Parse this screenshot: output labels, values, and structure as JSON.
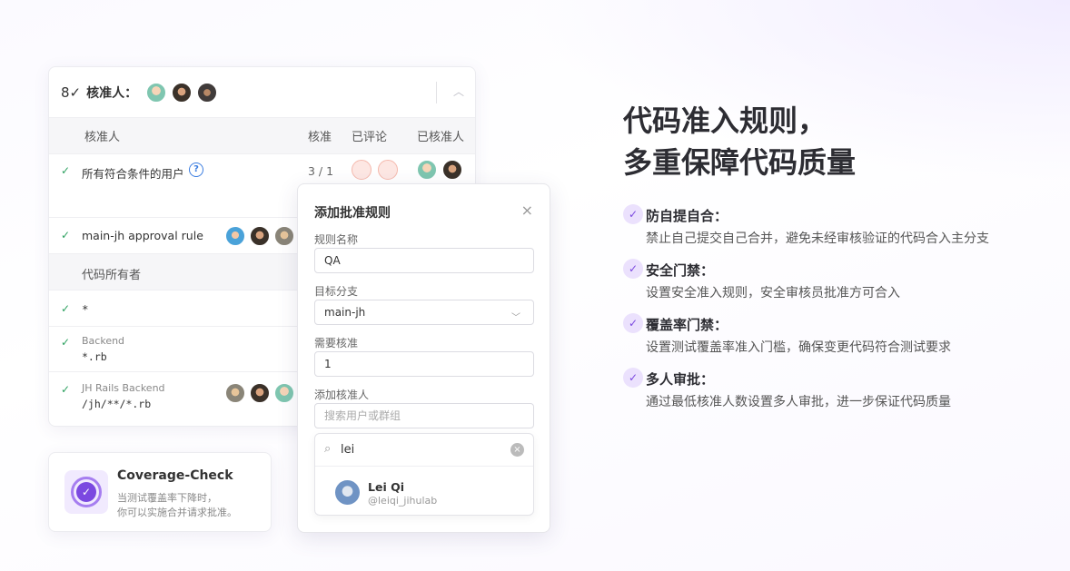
{
  "approvers_card": {
    "header_icon": "user-check-icon",
    "header_title": "核准人：",
    "table_headers": {
      "approvers": "核准人",
      "approve": "核准",
      "commented": "已评论",
      "approved_by": "已核准人"
    },
    "rows": [
      {
        "label": "所有符合条件的用户",
        "count": "3 / 1"
      },
      {
        "label": "main-jh approval rule"
      }
    ],
    "code_owners_header": "代码所有者",
    "code_owner_rows": [
      {
        "path": "*"
      },
      {
        "sub": "Backend",
        "path": "*.rb"
      },
      {
        "sub": "JH Rails Backend",
        "path": "/jh/**/*.rb"
      }
    ]
  },
  "coverage_card": {
    "title": "Coverage-Check",
    "desc_line1": "当测试覆盖率下降时，",
    "desc_line2": "你可以实施合并请求批准。"
  },
  "modal": {
    "title": "添加批准规则",
    "close": "×",
    "rule_name_label": "规则名称",
    "rule_name_value": "QA",
    "target_branch_label": "目标分支",
    "target_branch_value": "main-jh",
    "required_label": "需要核准",
    "required_value": "1",
    "add_approvers_label": "添加核准人",
    "add_approvers_placeholder": "搜索用户或群组",
    "search_value": "lei",
    "result_name": "Lei Qi",
    "result_handle": "@leiqi_jihulab"
  },
  "headline": {
    "line1": "代码准入规则，",
    "line2": "多重保障代码质量"
  },
  "features": [
    {
      "title": "防自提自合：",
      "desc": "禁止自己提交自己合并，避免未经审核验证的代码合入主分支"
    },
    {
      "title": "安全门禁：",
      "desc": "设置安全准入规则，安全审核员批准方可合入"
    },
    {
      "title": "覆盖率门禁：",
      "desc": "设置测试覆盖率准入门槛，确保变更代码符合测试要求"
    },
    {
      "title": "多人审批：",
      "desc": "通过最低核准人数设置多人审批，进一步保证代码质量"
    }
  ],
  "colors": {
    "accent": "#7b49e0",
    "check_green": "#2da160",
    "link_blue": "#3b7de0"
  }
}
